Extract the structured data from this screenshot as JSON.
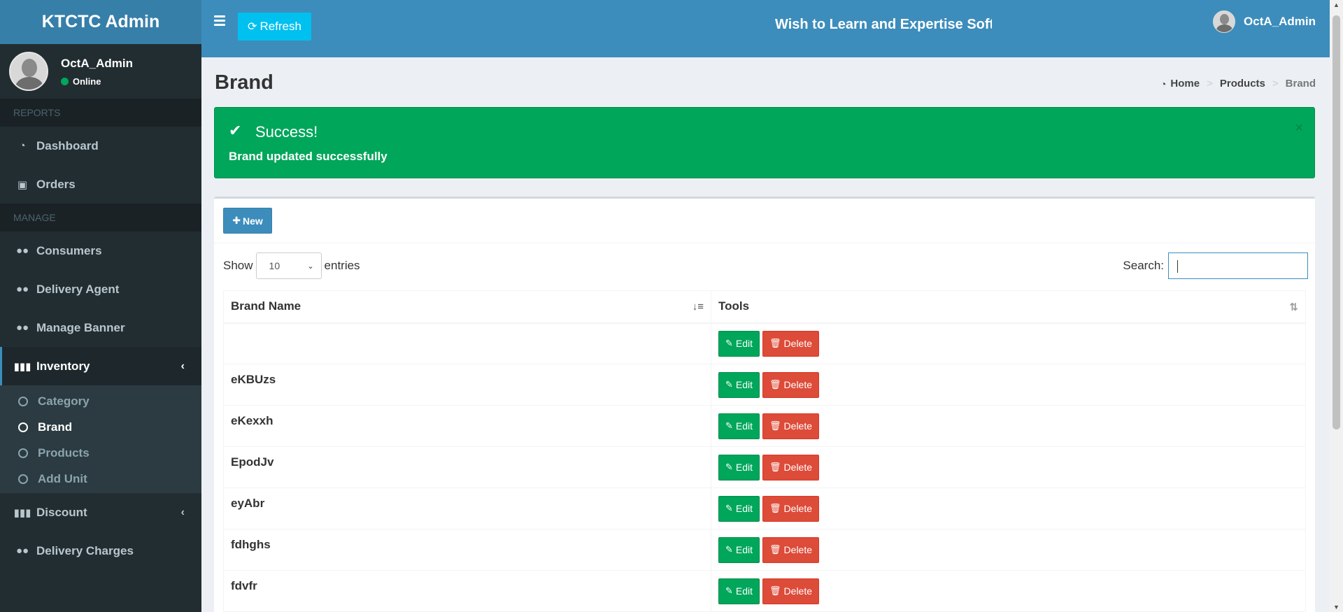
{
  "app": {
    "title": "KTCTC Admin"
  },
  "user": {
    "name": "OctA_Admin",
    "status": "Online"
  },
  "sidebar": {
    "sections": [
      {
        "header": "REPORTS",
        "items": [
          {
            "label": "Dashboard",
            "icon": "dashboard-icon"
          },
          {
            "label": "Orders",
            "icon": "money-icon"
          }
        ]
      },
      {
        "header": "MANAGE",
        "items": [
          {
            "label": "Consumers",
            "icon": "users-icon"
          },
          {
            "label": "Delivery Agent",
            "icon": "users-icon"
          },
          {
            "label": "Manage Banner",
            "icon": "users-icon"
          },
          {
            "label": "Inventory",
            "icon": "barcode-icon",
            "expanded": true,
            "children": [
              "Category",
              "Brand",
              "Products",
              "Add Unit"
            ],
            "active_child": "Brand"
          },
          {
            "label": "Discount",
            "icon": "barcode-icon"
          },
          {
            "label": "Delivery Charges",
            "icon": "users-icon"
          }
        ]
      }
    ]
  },
  "header": {
    "refresh_label": "Refresh",
    "marquee": "Wish to Learn and Expertise Softv",
    "user_name": "OctA_Admin"
  },
  "page": {
    "title": "Brand",
    "breadcrumb": [
      "Home",
      "Products",
      "Brand"
    ]
  },
  "alert": {
    "title": "Success!",
    "message": "Brand updated successfully",
    "close": "×"
  },
  "toolbar": {
    "new_label": "New"
  },
  "table_controls": {
    "show_label": "Show",
    "entries_value": "10",
    "entries_label": "entries",
    "search_label": "Search:",
    "search_value": ""
  },
  "table": {
    "columns": [
      "Brand Name",
      "Tools"
    ],
    "edit_label": "Edit",
    "delete_label": "Delete",
    "rows": [
      "",
      "eKBUzs",
      "eKexxh",
      "EpodJv",
      "eyAbr",
      "fdhghs",
      "fdvfr"
    ]
  },
  "colors": {
    "header": "#3c8dbc",
    "sidebar": "#222d32",
    "success": "#00a65a",
    "danger": "#dd4b39",
    "info": "#00c0ef"
  }
}
